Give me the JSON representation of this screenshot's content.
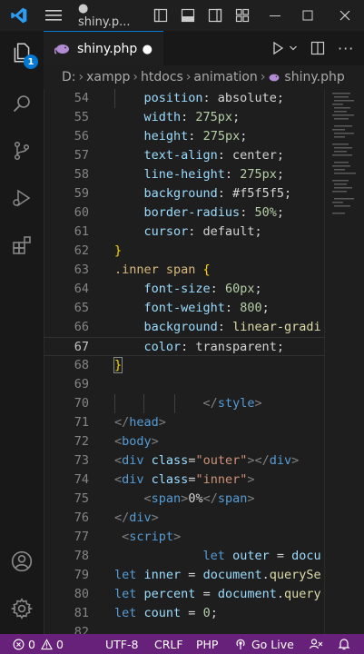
{
  "titlebar": {
    "title": "● shiny.p...",
    "colors": {
      "accent": "#0078d4"
    }
  },
  "activity_bar": {
    "explorer_badge": "1",
    "icons": [
      "files-icon",
      "search-icon",
      "source-control-icon",
      "run-debug-icon",
      "extensions-icon",
      "account-icon",
      "settings-gear-icon"
    ]
  },
  "tab": {
    "filename": "shiny.php",
    "modified_indicator": "●"
  },
  "breadcrumb": {
    "parts": [
      "D:",
      "xampp",
      "htdocs",
      "animation",
      "shiny.php"
    ]
  },
  "editor": {
    "lines": [
      {
        "n": "54",
        "text": "    position: absolute;"
      },
      {
        "n": "55",
        "text": "    width: 275px;"
      },
      {
        "n": "56",
        "text": "    height: 275px;"
      },
      {
        "n": "57",
        "text": "    text-align: center;"
      },
      {
        "n": "58",
        "text": "    line-height: 275px;"
      },
      {
        "n": "59",
        "text": "    background: #f5f5f5;"
      },
      {
        "n": "60",
        "text": "    border-radius: 50%;"
      },
      {
        "n": "61",
        "text": "    cursor: default;"
      },
      {
        "n": "62",
        "text": "}"
      },
      {
        "n": "63",
        "text": ".inner span {"
      },
      {
        "n": "64",
        "text": "    font-size: 60px;"
      },
      {
        "n": "65",
        "text": "    font-weight: 800;"
      },
      {
        "n": "66",
        "text": "    background: linear-gradi"
      },
      {
        "n": "67",
        "text": "    color: transparent;"
      },
      {
        "n": "68",
        "text": "}"
      },
      {
        "n": "69",
        "text": ""
      },
      {
        "n": "70",
        "text": "            </style>"
      },
      {
        "n": "71",
        "text": "</head>"
      },
      {
        "n": "72",
        "text": "<body>"
      },
      {
        "n": "73",
        "text": "<div class=\"outer\"></div>"
      },
      {
        "n": "74",
        "text": "<div class=\"inner\">"
      },
      {
        "n": "75",
        "text": "    <span>0%</span>"
      },
      {
        "n": "76",
        "text": "</div>"
      },
      {
        "n": "77",
        "text": " <script>"
      },
      {
        "n": "78",
        "text": "            let outer = docu"
      },
      {
        "n": "79",
        "text": "let inner = document.querySe"
      },
      {
        "n": "80",
        "text": "let percent = document.query"
      },
      {
        "n": "81",
        "text": "let count = 0;"
      },
      {
        "n": "82",
        "text": ""
      }
    ]
  },
  "statusbar": {
    "errors": "0",
    "warnings": "0",
    "encoding": "UTF-8",
    "eol": "CRLF",
    "language": "PHP",
    "go_live": "Go Live",
    "bg_color": "#68217a"
  }
}
